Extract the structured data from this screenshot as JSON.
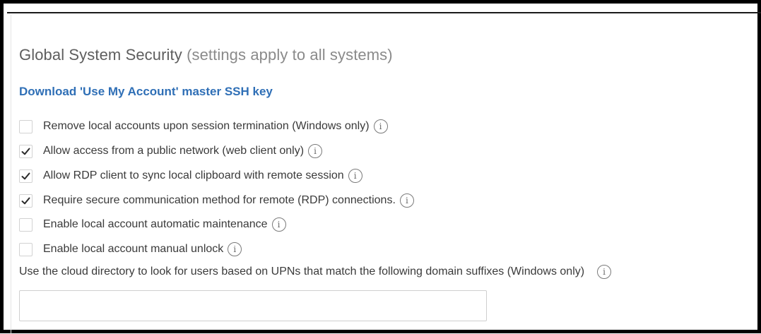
{
  "section": {
    "title": "Global System Security",
    "subtitle": "(settings apply to all systems)"
  },
  "download_link": "Download 'Use My Account' master SSH key",
  "options": [
    {
      "label": "Remove local accounts upon session termination (Windows only)",
      "checked": false
    },
    {
      "label": "Allow access from a public network (web client only)",
      "checked": true
    },
    {
      "label": "Allow RDP client to sync local clipboard with remote session",
      "checked": true
    },
    {
      "label": "Require secure communication method for remote (RDP) connections.",
      "checked": true
    },
    {
      "label": "Enable local account automatic maintenance",
      "checked": false
    },
    {
      "label": "Enable local account manual unlock",
      "checked": false
    }
  ],
  "upn": {
    "label": "Use the cloud directory to look for users based on UPNs that match the following domain suffixes (Windows only)",
    "value": "",
    "placeholder": ""
  },
  "icons": {
    "info": "info-icon",
    "check": "checkmark-icon"
  },
  "colors": {
    "link": "#2f6fb6",
    "title": "#5e5e5e",
    "text": "#3a3a3a"
  }
}
